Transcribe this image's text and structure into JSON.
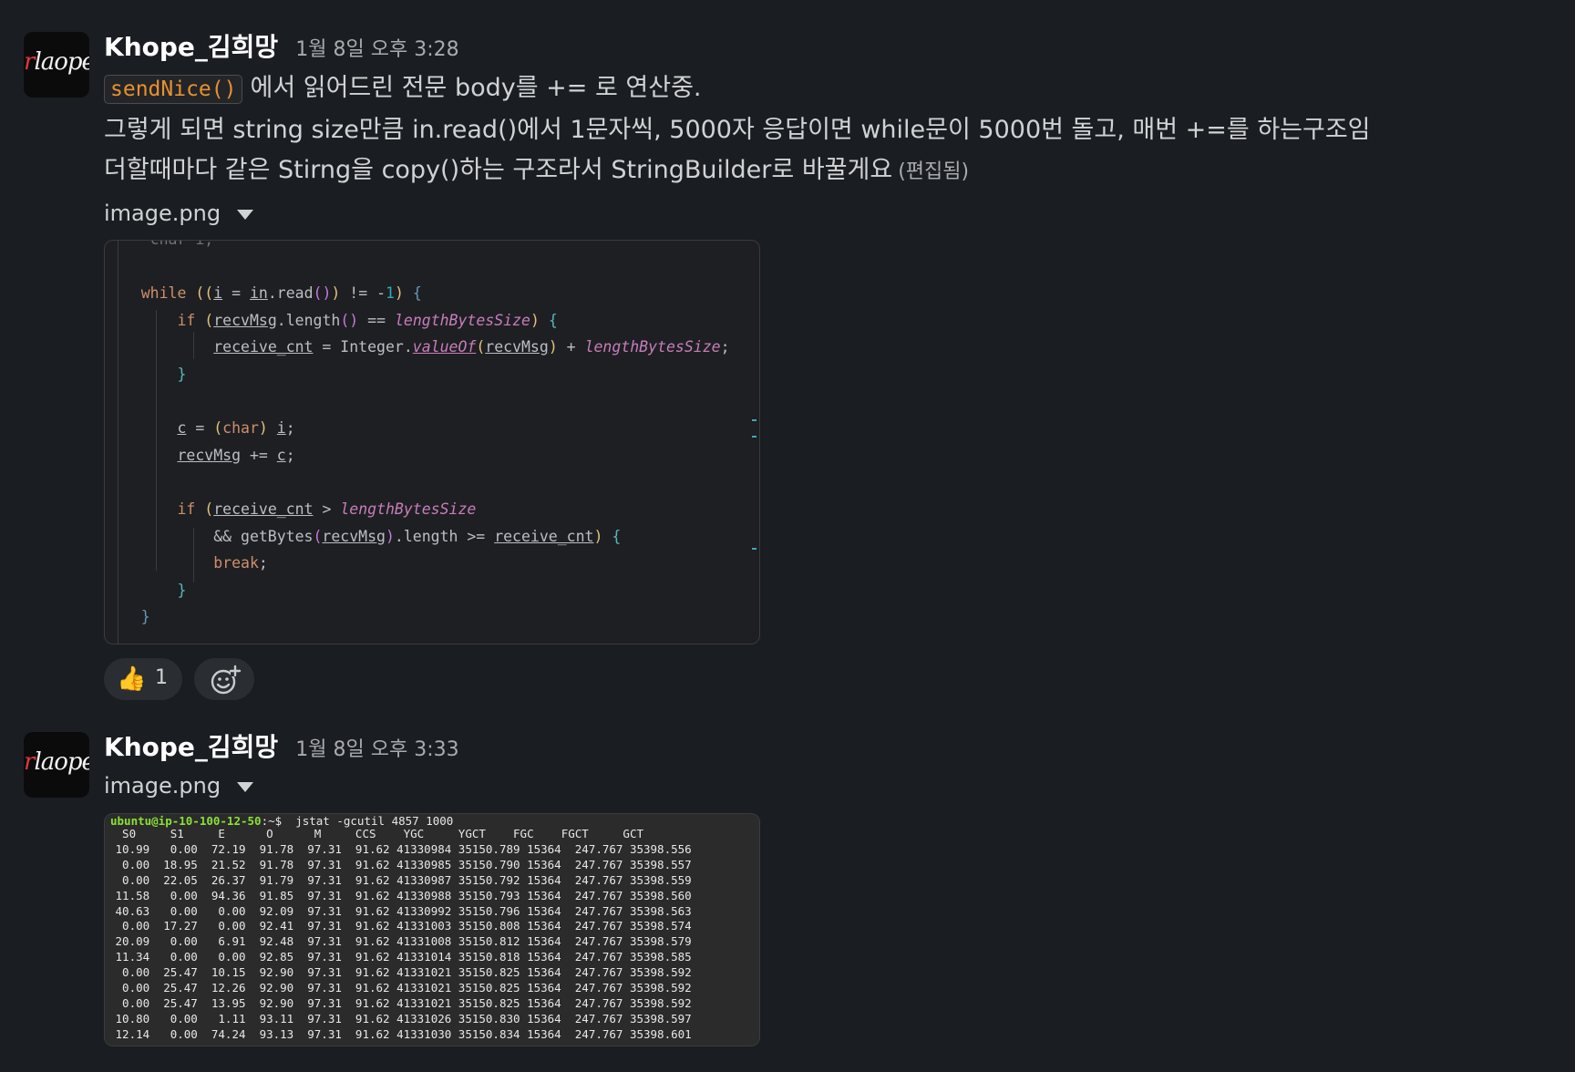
{
  "top_cut_text": "~~ ~~~~ ~~~ ~~~~ ~~~~ ~~~~ ~~.",
  "messages": [
    {
      "author": "Khope_김희망",
      "timestamp": "1월 8일 오후 3:28",
      "inline_code": "sendNice()",
      "line1_rest": "에서 읽어드린 전문 body를 += 로 연산중.",
      "line2": "그렇게 되면 string size만큼 in.read()에서 1문자씩, 5000자 응답이면 while문이 5000번 돌고, 매번 +=를 하는구조임",
      "line3": "더할때마다 같은 Stirng을 copy()하는 구조라서 StringBuilder로 바꿀게요",
      "edited": "(편집됨)",
      "attachment_name": "image.png",
      "reactions": [
        {
          "icon": "thumbs-up-icon",
          "count": "1"
        }
      ],
      "add_reaction_icon": "add-emoji-icon"
    },
    {
      "author": "Khope_김희망",
      "timestamp": "1월 8일 오후 3:33",
      "attachment_name": "image.png"
    }
  ],
  "terminal": {
    "prompt_user": "ubuntu@ip-10-100-12-50",
    "prompt_rest": ":~$  jstat -gcutil 4857 1000",
    "header": "  S0     S1     E      O      M     CCS    YGC     YGCT    FGC    FGCT     GCT",
    "rows": [
      " 10.99   0.00  72.19  91.78  97.31  91.62 41330984 35150.789 15364  247.767 35398.556",
      "  0.00  18.95  21.52  91.78  97.31  91.62 41330985 35150.790 15364  247.767 35398.557",
      "  0.00  22.05  26.37  91.79  97.31  91.62 41330987 35150.792 15364  247.767 35398.559",
      " 11.58   0.00  94.36  91.85  97.31  91.62 41330988 35150.793 15364  247.767 35398.560",
      " 40.63   0.00   0.00  92.09  97.31  91.62 41330992 35150.796 15364  247.767 35398.563",
      "  0.00  17.27   0.00  92.41  97.31  91.62 41331003 35150.808 15364  247.767 35398.574",
      " 20.09   0.00   6.91  92.48  97.31  91.62 41331008 35150.812 15364  247.767 35398.579",
      " 11.34   0.00   0.00  92.85  97.31  91.62 41331014 35150.818 15364  247.767 35398.585",
      "  0.00  25.47  10.15  92.90  97.31  91.62 41331021 35150.825 15364  247.767 35398.592",
      "  0.00  25.47  12.26  92.90  97.31  91.62 41331021 35150.825 15364  247.767 35398.592",
      "  0.00  25.47  13.95  92.90  97.31  91.62 41331021 35150.825 15364  247.767 35398.592",
      " 10.80   0.00   1.11  93.11  97.31  91.62 41331026 35150.830 15364  247.767 35398.597",
      " 12.14   0.00  74.24  93.13  97.31  91.62 41331030 35150.834 15364  247.767 35398.601"
    ]
  }
}
